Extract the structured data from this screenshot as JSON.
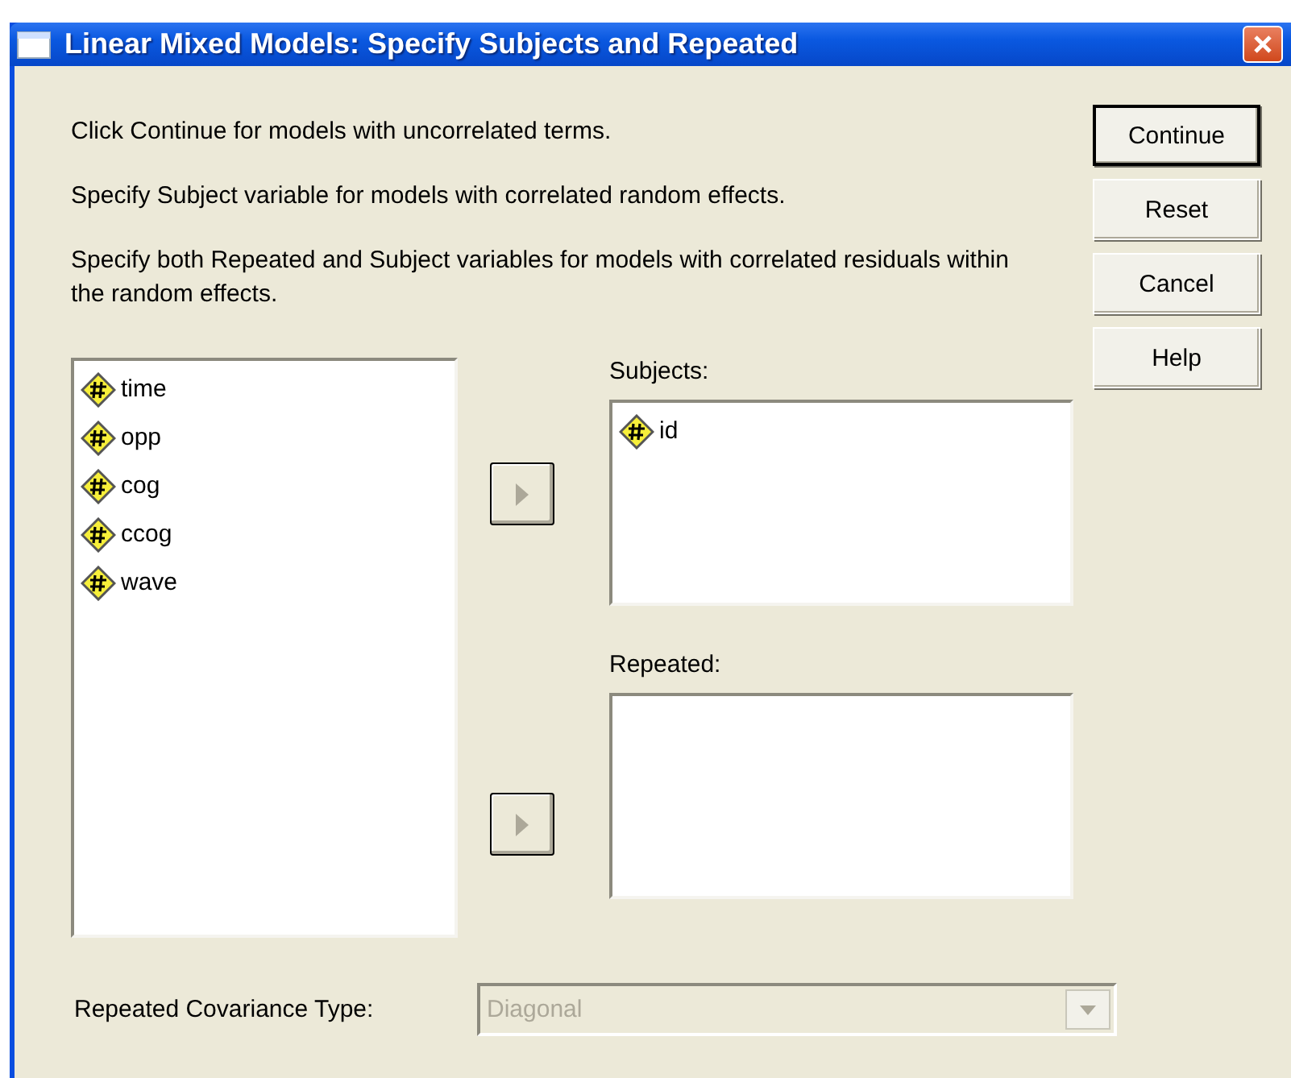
{
  "window": {
    "title": "Linear Mixed Models: Specify Subjects and Repeated"
  },
  "instructions": [
    "Click Continue for models with uncorrelated terms.",
    "Specify Subject variable for models with correlated random effects.",
    "Specify both Repeated and Subject variables for models with correlated residuals within the random effects."
  ],
  "buttons": [
    {
      "label": "Continue",
      "default": true
    },
    {
      "label": "Reset",
      "default": false
    },
    {
      "label": "Cancel",
      "default": false
    },
    {
      "label": "Help",
      "default": false
    }
  ],
  "variables": [
    "time",
    "opp",
    "cog",
    "ccog",
    "wave"
  ],
  "transfer_buttons": [
    {
      "disabled": true
    },
    {
      "disabled": true
    }
  ],
  "subjects": {
    "label": "Subjects:",
    "items": [
      "id"
    ]
  },
  "repeated": {
    "label": "Repeated:"
  },
  "covariance": {
    "label": "Repeated Covariance Type:",
    "value": "Diagonal",
    "disabled": true
  }
}
